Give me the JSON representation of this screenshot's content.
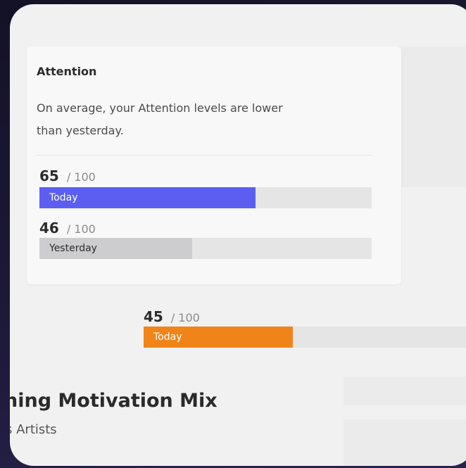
{
  "attention_card": {
    "title": "Attention",
    "description": "On average, your Attention levels are lower than yesterday.",
    "today": {
      "score": "65",
      "max": "/ 100",
      "label": "Today",
      "fraction": 0.65,
      "color": "#5b5ef0"
    },
    "yesterday": {
      "score": "46",
      "max": "/ 100",
      "label": "Yesterday",
      "fraction": 0.46,
      "color": "#cdcdcf"
    }
  },
  "second_metric": {
    "today": {
      "score": "45",
      "max": "/ 100",
      "label": "Today",
      "fraction": 0.45,
      "color": "#f08419"
    }
  },
  "playlist": {
    "title": "hing Motivation Mix",
    "subtitle": "s Artists"
  }
}
